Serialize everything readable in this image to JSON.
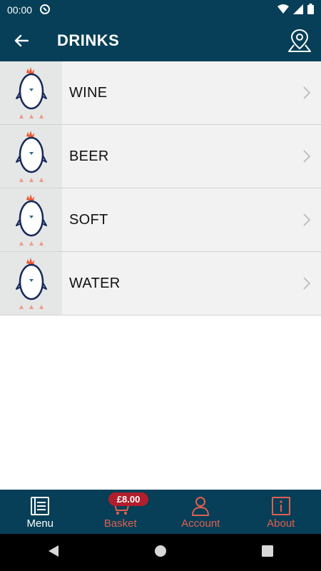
{
  "status_bar": {
    "time": "00:00"
  },
  "app_bar": {
    "title": "DRINKS"
  },
  "categories": [
    {
      "label": "WINE"
    },
    {
      "label": "BEER"
    },
    {
      "label": "SOFT"
    },
    {
      "label": "WATER"
    }
  ],
  "tab_bar": {
    "tabs": [
      {
        "label": "Menu",
        "icon": "menu-book-icon",
        "active": true
      },
      {
        "label": "Basket",
        "icon": "basket-cart-icon",
        "active": false,
        "badge": "£8.00"
      },
      {
        "label": "Account",
        "icon": "account-person-icon",
        "active": false
      },
      {
        "label": "About",
        "icon": "info-icon",
        "active": false
      }
    ]
  },
  "colors": {
    "primary": "#063f57",
    "accent": "#e0604e",
    "badge": "#b21e2c",
    "row_bg": "#f2f2f2"
  }
}
